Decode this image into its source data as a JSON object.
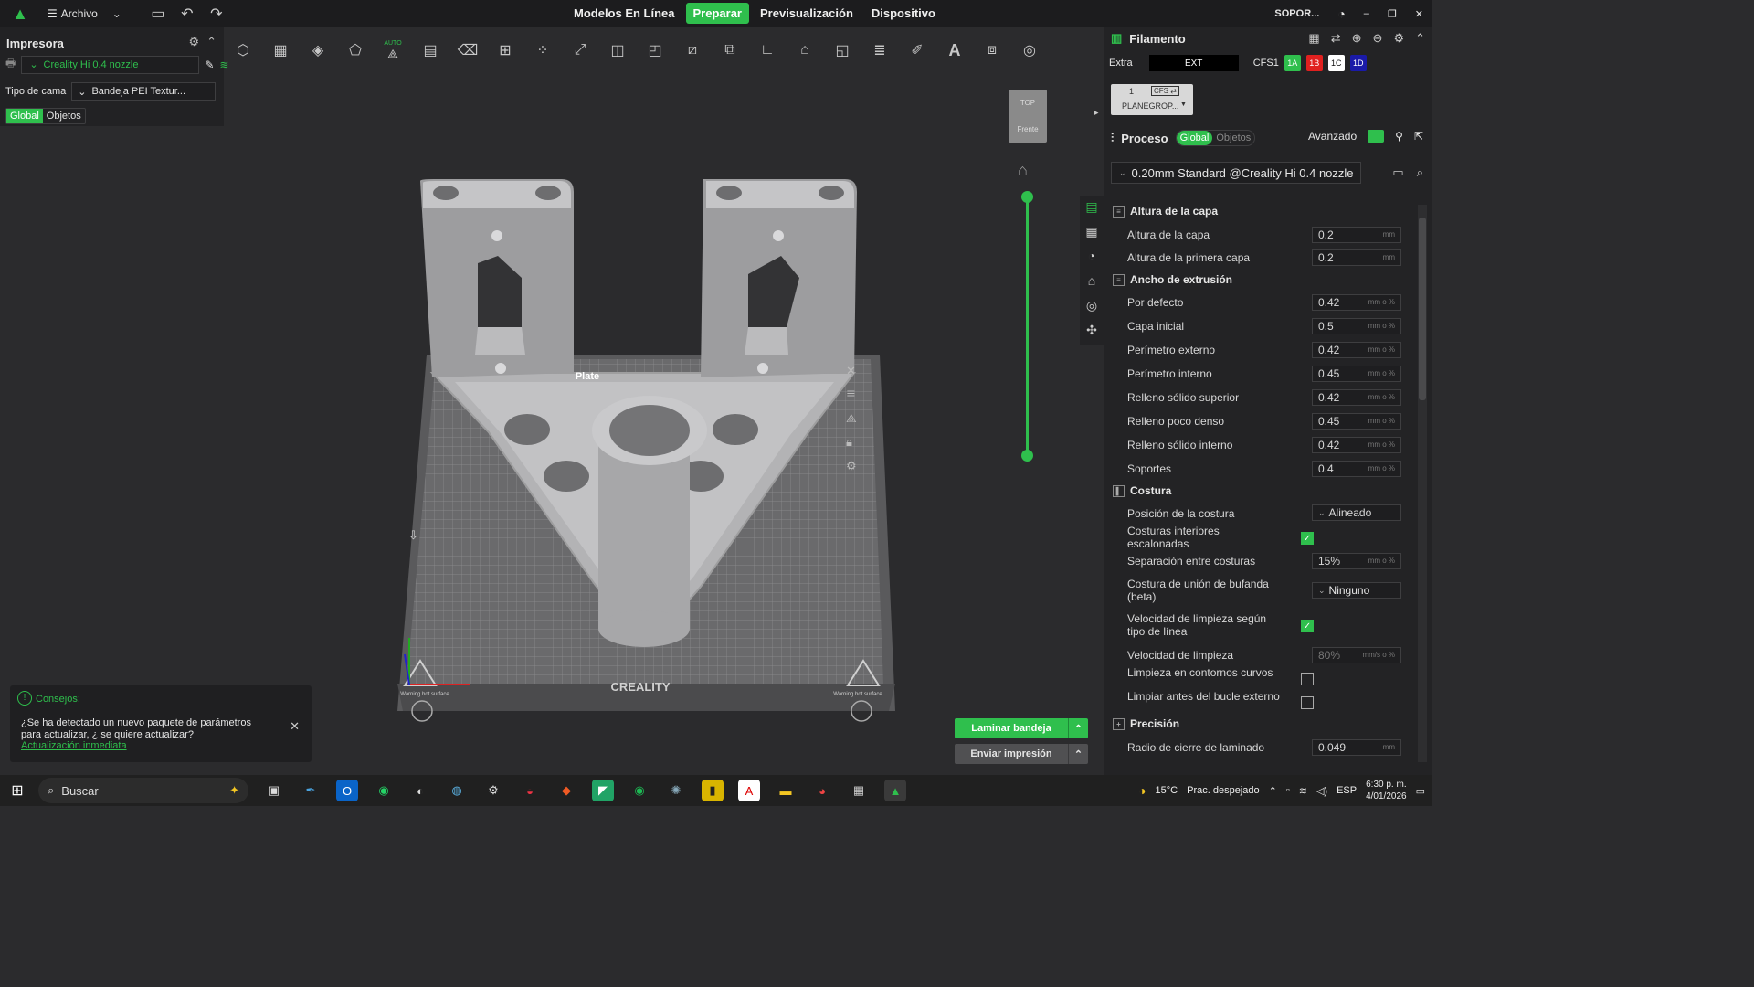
{
  "topbar": {
    "menu_label": "Archivo",
    "nav": [
      "Modelos En Línea",
      "Preparar",
      "Previsualización",
      "Dispositivo"
    ],
    "active_nav": "Preparar",
    "user": "SOPOR..."
  },
  "left": {
    "title": "Impresora",
    "printer": "Creality Hi 0.4 nozzle",
    "bed_label": "Tipo de cama",
    "bed_value": "Bandeja PEI Textur...",
    "tab_global": "Global",
    "tab_objects": "Objetos"
  },
  "toolbar": {
    "auto_label": "AUTO"
  },
  "viewport": {
    "plate_label": "Plate",
    "bed_brand": "CREALITY",
    "warning_left": "Warning hot surface",
    "warning_right": "Warning hot surface",
    "viewcube_top": "TOP",
    "viewcube_front": "Frente"
  },
  "tips": {
    "title": "Consejos:",
    "message": "¿Se ha detectado un nuevo paquete de parámetros para actualizar, ¿ se quiere actualizar?",
    "link": "Actualización inmediata"
  },
  "actions": {
    "slice": "Laminar bandeja",
    "send": "Enviar impresión"
  },
  "filament": {
    "title": "Filamento",
    "extra_label": "Extra",
    "ext": "EXT",
    "cfs": "CFS1",
    "chips": [
      {
        "label": "1A",
        "color": "#2fbf4d"
      },
      {
        "label": "1B",
        "color": "#e0201f"
      },
      {
        "label": "1C",
        "color": "#ffffff"
      },
      {
        "label": "1D",
        "color": "#1a1aa8"
      }
    ],
    "slot_num": "1",
    "slot_tag": "CFS ⇄",
    "slot_name": "PLANEGROP..."
  },
  "process": {
    "title": "Proceso",
    "tab_global": "Global",
    "tab_objects": "Objetos",
    "advanced": "Avanzado",
    "preset": "0.20mm Standard @Creality Hi 0.4 nozzle"
  },
  "settings": {
    "sec_layer": "Altura de la capa",
    "layer_height": {
      "label": "Altura de la capa",
      "value": "0.2",
      "unit": "mm"
    },
    "first_layer": {
      "label": "Altura de la primera capa",
      "value": "0.2",
      "unit": "mm"
    },
    "sec_width": "Ancho de extrusión",
    "widths": [
      {
        "label": "Por defecto",
        "value": "0.42",
        "unit": "mm o %"
      },
      {
        "label": "Capa inicial",
        "value": "0.5",
        "unit": "mm o %"
      },
      {
        "label": "Perímetro externo",
        "value": "0.42",
        "unit": "mm o %"
      },
      {
        "label": "Perímetro interno",
        "value": "0.45",
        "unit": "mm o %"
      },
      {
        "label": "Relleno sólido superior",
        "value": "0.42",
        "unit": "mm o %"
      },
      {
        "label": "Relleno poco denso",
        "value": "0.45",
        "unit": "mm o %"
      },
      {
        "label": "Relleno sólido interno",
        "value": "0.42",
        "unit": "mm o %"
      },
      {
        "label": "Soportes",
        "value": "0.4",
        "unit": "mm o %"
      }
    ],
    "sec_seam": "Costura",
    "seam_pos": {
      "label": "Posición de la costura",
      "value": "Alineado"
    },
    "staggered": {
      "label": "Costuras interiores escalonadas",
      "checked": true
    },
    "seam_gap": {
      "label": "Separación entre costuras",
      "value": "15%",
      "unit": "mm o %"
    },
    "scarf": {
      "label": "Costura de unión de bufanda (beta)",
      "value": "Ninguno"
    },
    "wipe_speed_type": {
      "label": "Velocidad de limpieza según tipo de línea",
      "checked": true
    },
    "wipe_speed": {
      "label": "Velocidad de limpieza",
      "value": "80%",
      "unit": "mm/s o %"
    },
    "wipe_curved": {
      "label": "Limpieza en contornos curvos",
      "checked": false
    },
    "wipe_before": {
      "label": "Limpiar antes del bucle externo",
      "checked": false
    },
    "sec_precision": "Precisión",
    "slice_closing": {
      "label": "Radio de cierre de laminado",
      "value": "0.049",
      "unit": "mm"
    }
  },
  "taskbar": {
    "search": "Buscar",
    "weather_temp": "15°C",
    "weather_desc": "Prac. despejado",
    "lang": "ESP",
    "time": "6:30 p. m.",
    "date": "4/01/2026"
  }
}
